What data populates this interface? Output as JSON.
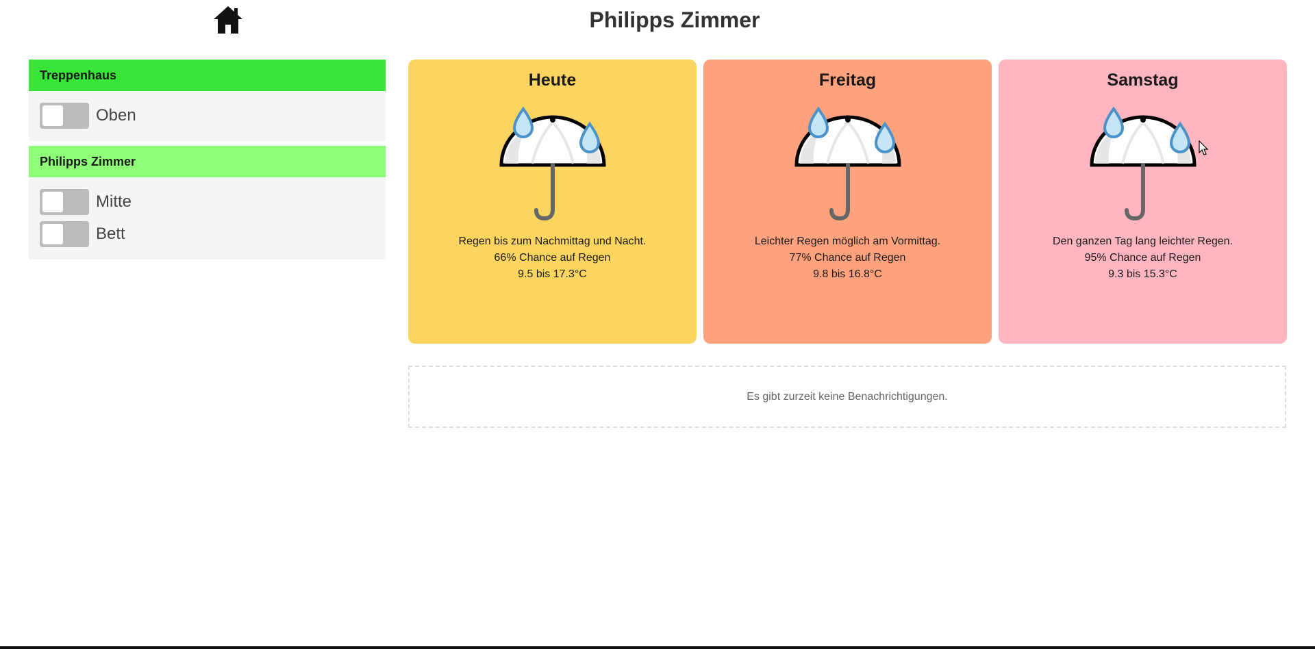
{
  "header": {
    "title": "Philipps Zimmer",
    "home_icon": "home-icon"
  },
  "groups": [
    {
      "title": "Treppenhaus",
      "color": "#39e539",
      "switches": [
        {
          "label": "Oben",
          "on": false
        }
      ]
    },
    {
      "title": "Philipps Zimmer",
      "color": "#8fff7a",
      "switches": [
        {
          "label": "Mitte",
          "on": false
        },
        {
          "label": "Bett",
          "on": false
        }
      ]
    }
  ],
  "forecast": [
    {
      "day": "Heute",
      "icon": "umbrella-rain-icon",
      "bg": "#fcd561",
      "summary": "Regen bis zum Nachmittag und Nacht.",
      "chance": "66% Chance auf Regen",
      "temp": "9.5 bis 17.3°C"
    },
    {
      "day": "Freitag",
      "icon": "umbrella-rain-icon",
      "bg": "#ffa27d",
      "summary": "Leichter Regen möglich am Vormittag.",
      "chance": "77% Chance auf Regen",
      "temp": "9.8 bis 16.8°C"
    },
    {
      "day": "Samstag",
      "icon": "umbrella-rain-icon",
      "bg": "#ffb6c0",
      "summary": "Den ganzen Tag lang leichter Regen.",
      "chance": "95% Chance auf Regen",
      "temp": "9.3 bis 15.3°C"
    }
  ],
  "notifications": {
    "empty_text": "Es gibt zurzeit keine Benachrichtigungen."
  }
}
